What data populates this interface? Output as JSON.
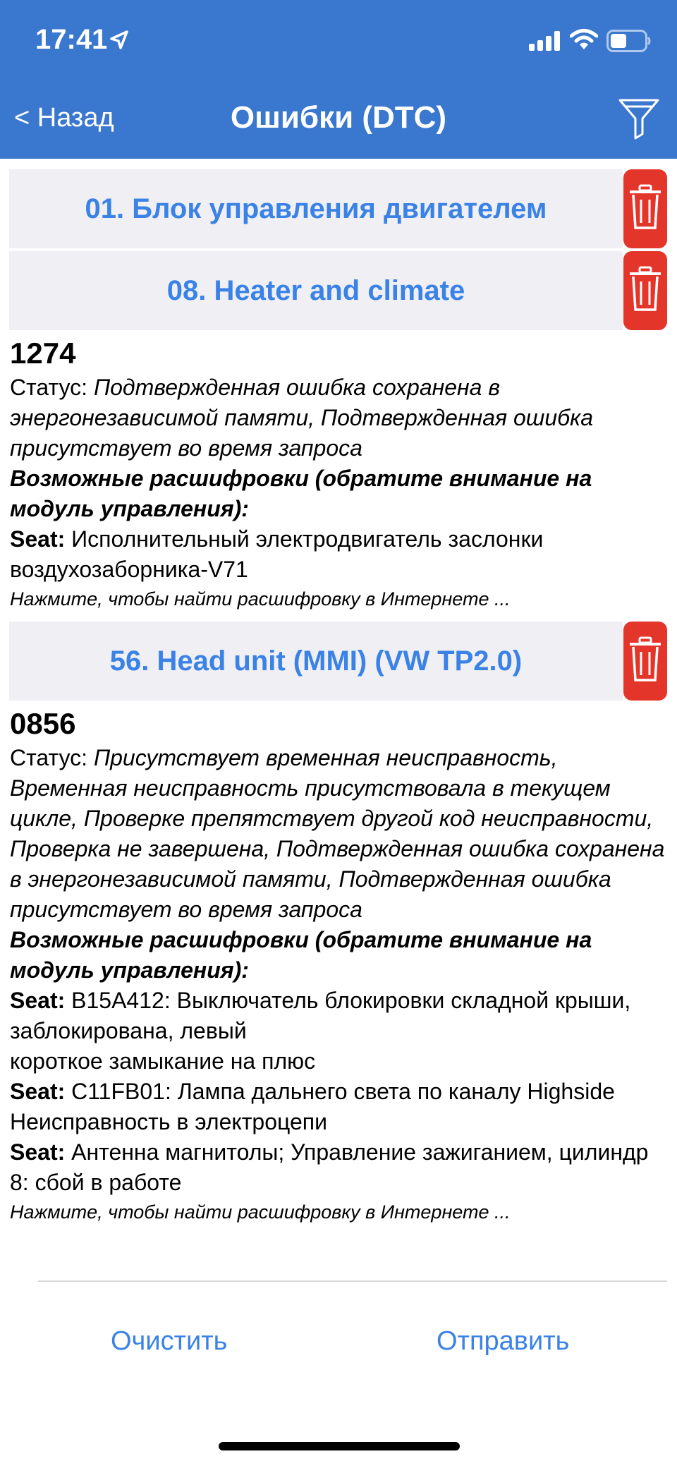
{
  "status_bar": {
    "time": "17:41",
    "icons": [
      "location-arrow-icon",
      "signal-icon",
      "wifi-icon",
      "battery-icon"
    ]
  },
  "nav": {
    "back_label": "< Назад",
    "title": "Ошибки (DTC)",
    "filter_icon": "filter-icon"
  },
  "modules": [
    {
      "title": "01. Блок управления двигателем",
      "dtcs": []
    },
    {
      "title": "08. Heater and climate",
      "dtcs": [
        {
          "code": "1274",
          "status_label": "Статус:",
          "status_value": "Подтвержденная ошибка сохранена в энергонезависимой памяти, Подтвержденная ошибка присутствует во время запроса",
          "decode_title": "Возможные расшифровки (обратите внимание на модуль управления):",
          "decodes": [
            {
              "brand": "Seat:",
              "lines": [
                "Исполнительный электродвигатель заслонки воздухозаборника-V71"
              ]
            }
          ],
          "search_link": "Нажмите, чтобы найти расшифровку в Интернете ..."
        }
      ]
    },
    {
      "title": "56. Head unit (MMI) (VW TP2.0)",
      "dtcs": [
        {
          "code": "0856",
          "status_label": "Статус:",
          "status_value": "Присутствует временная неисправность, Временная неисправность присутствовала в текущем цикле, Проверке препятствует другой код неисправности, Проверка не завершена, Подтвержденная ошибка сохранена в энергонезависимой памяти, Подтвержденная ошибка присутствует во время запроса",
          "decode_title": "Возможные расшифровки (обратите внимание на модуль управления):",
          "decodes": [
            {
              "brand": "Seat:",
              "lines": [
                "B15A412: Выключатель блокировки складной крыши, заблокирована, левый",
                "короткое замыкание на плюс"
              ]
            },
            {
              "brand": "Seat:",
              "lines": [
                "C11FB01: Лампа дальнего света по каналу Highside",
                "Неисправность в электроцепи"
              ]
            },
            {
              "brand": "Seat:",
              "lines": [
                "Антенна магнитолы; Управление зажиганием, цилиндр 8: сбой в работе"
              ]
            }
          ],
          "search_link": "Нажмите, чтобы найти расшифровку в Интернете ..."
        }
      ]
    }
  ],
  "footer": {
    "clear_label": "Очистить",
    "send_label": "Отправить"
  },
  "colors": {
    "header_bg": "#3a77cf",
    "link_blue": "#3a82e6",
    "trash_red": "#e4352b",
    "module_bg": "#efeff4"
  }
}
